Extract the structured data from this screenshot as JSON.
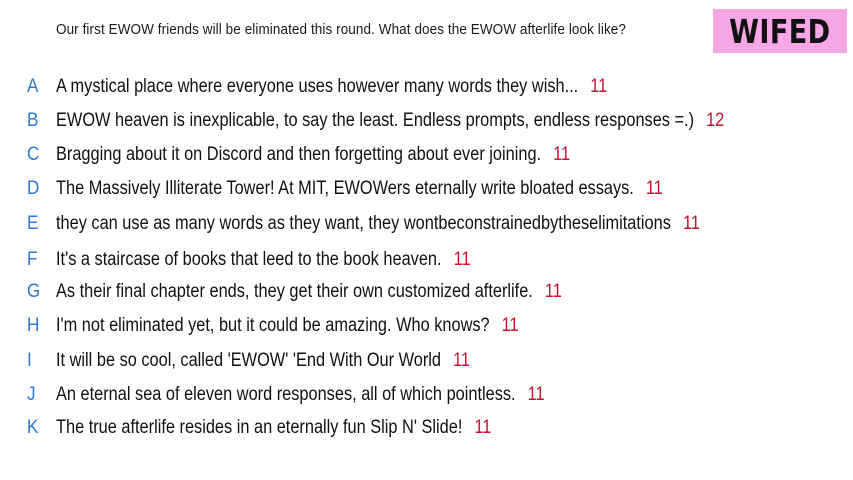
{
  "prompt": "Our first EWOW friends will be eliminated this round. What does the EWOW afterlife look like?",
  "badge": "WIFED",
  "responses": [
    {
      "letter": "A",
      "text": "A mystical place where everyone uses however many words they wish...",
      "count": "11"
    },
    {
      "letter": "B",
      "text": "EWOW heaven is inexplicable, to say the least. Endless prompts, endless responses =.)",
      "count": "12"
    },
    {
      "letter": "C",
      "text": "Bragging about it on Discord and then forgetting about ever joining.",
      "count": "11"
    },
    {
      "letter": "D",
      "text": "The Massively Illiterate Tower! At MIT, EWOWers eternally write bloated essays.",
      "count": "11"
    },
    {
      "letter": "E",
      "text": "they can use as many words as they want, they wontbeconstrainedbytheselimitations",
      "count": "11"
    },
    {
      "letter": "F",
      "text": "It's a staircase of books that leed to the book heaven.",
      "count": "11"
    },
    {
      "letter": "G",
      "text": "As their final chapter ends, they get their own customized afterlife.",
      "count": "11"
    },
    {
      "letter": "H",
      "text": "I'm not eliminated yet, but it could be amazing. Who knows?",
      "count": "11"
    },
    {
      "letter": "I",
      "text": "It will be so cool, called 'EWOW' 'End With Our World",
      "count": "11"
    },
    {
      "letter": "J",
      "text": "An eternal sea of eleven word responses, all of which pointless.",
      "count": "11"
    },
    {
      "letter": "K",
      "text": "The true afterlife resides in an eternally fun Slip N' Slide!",
      "count": "11"
    }
  ]
}
